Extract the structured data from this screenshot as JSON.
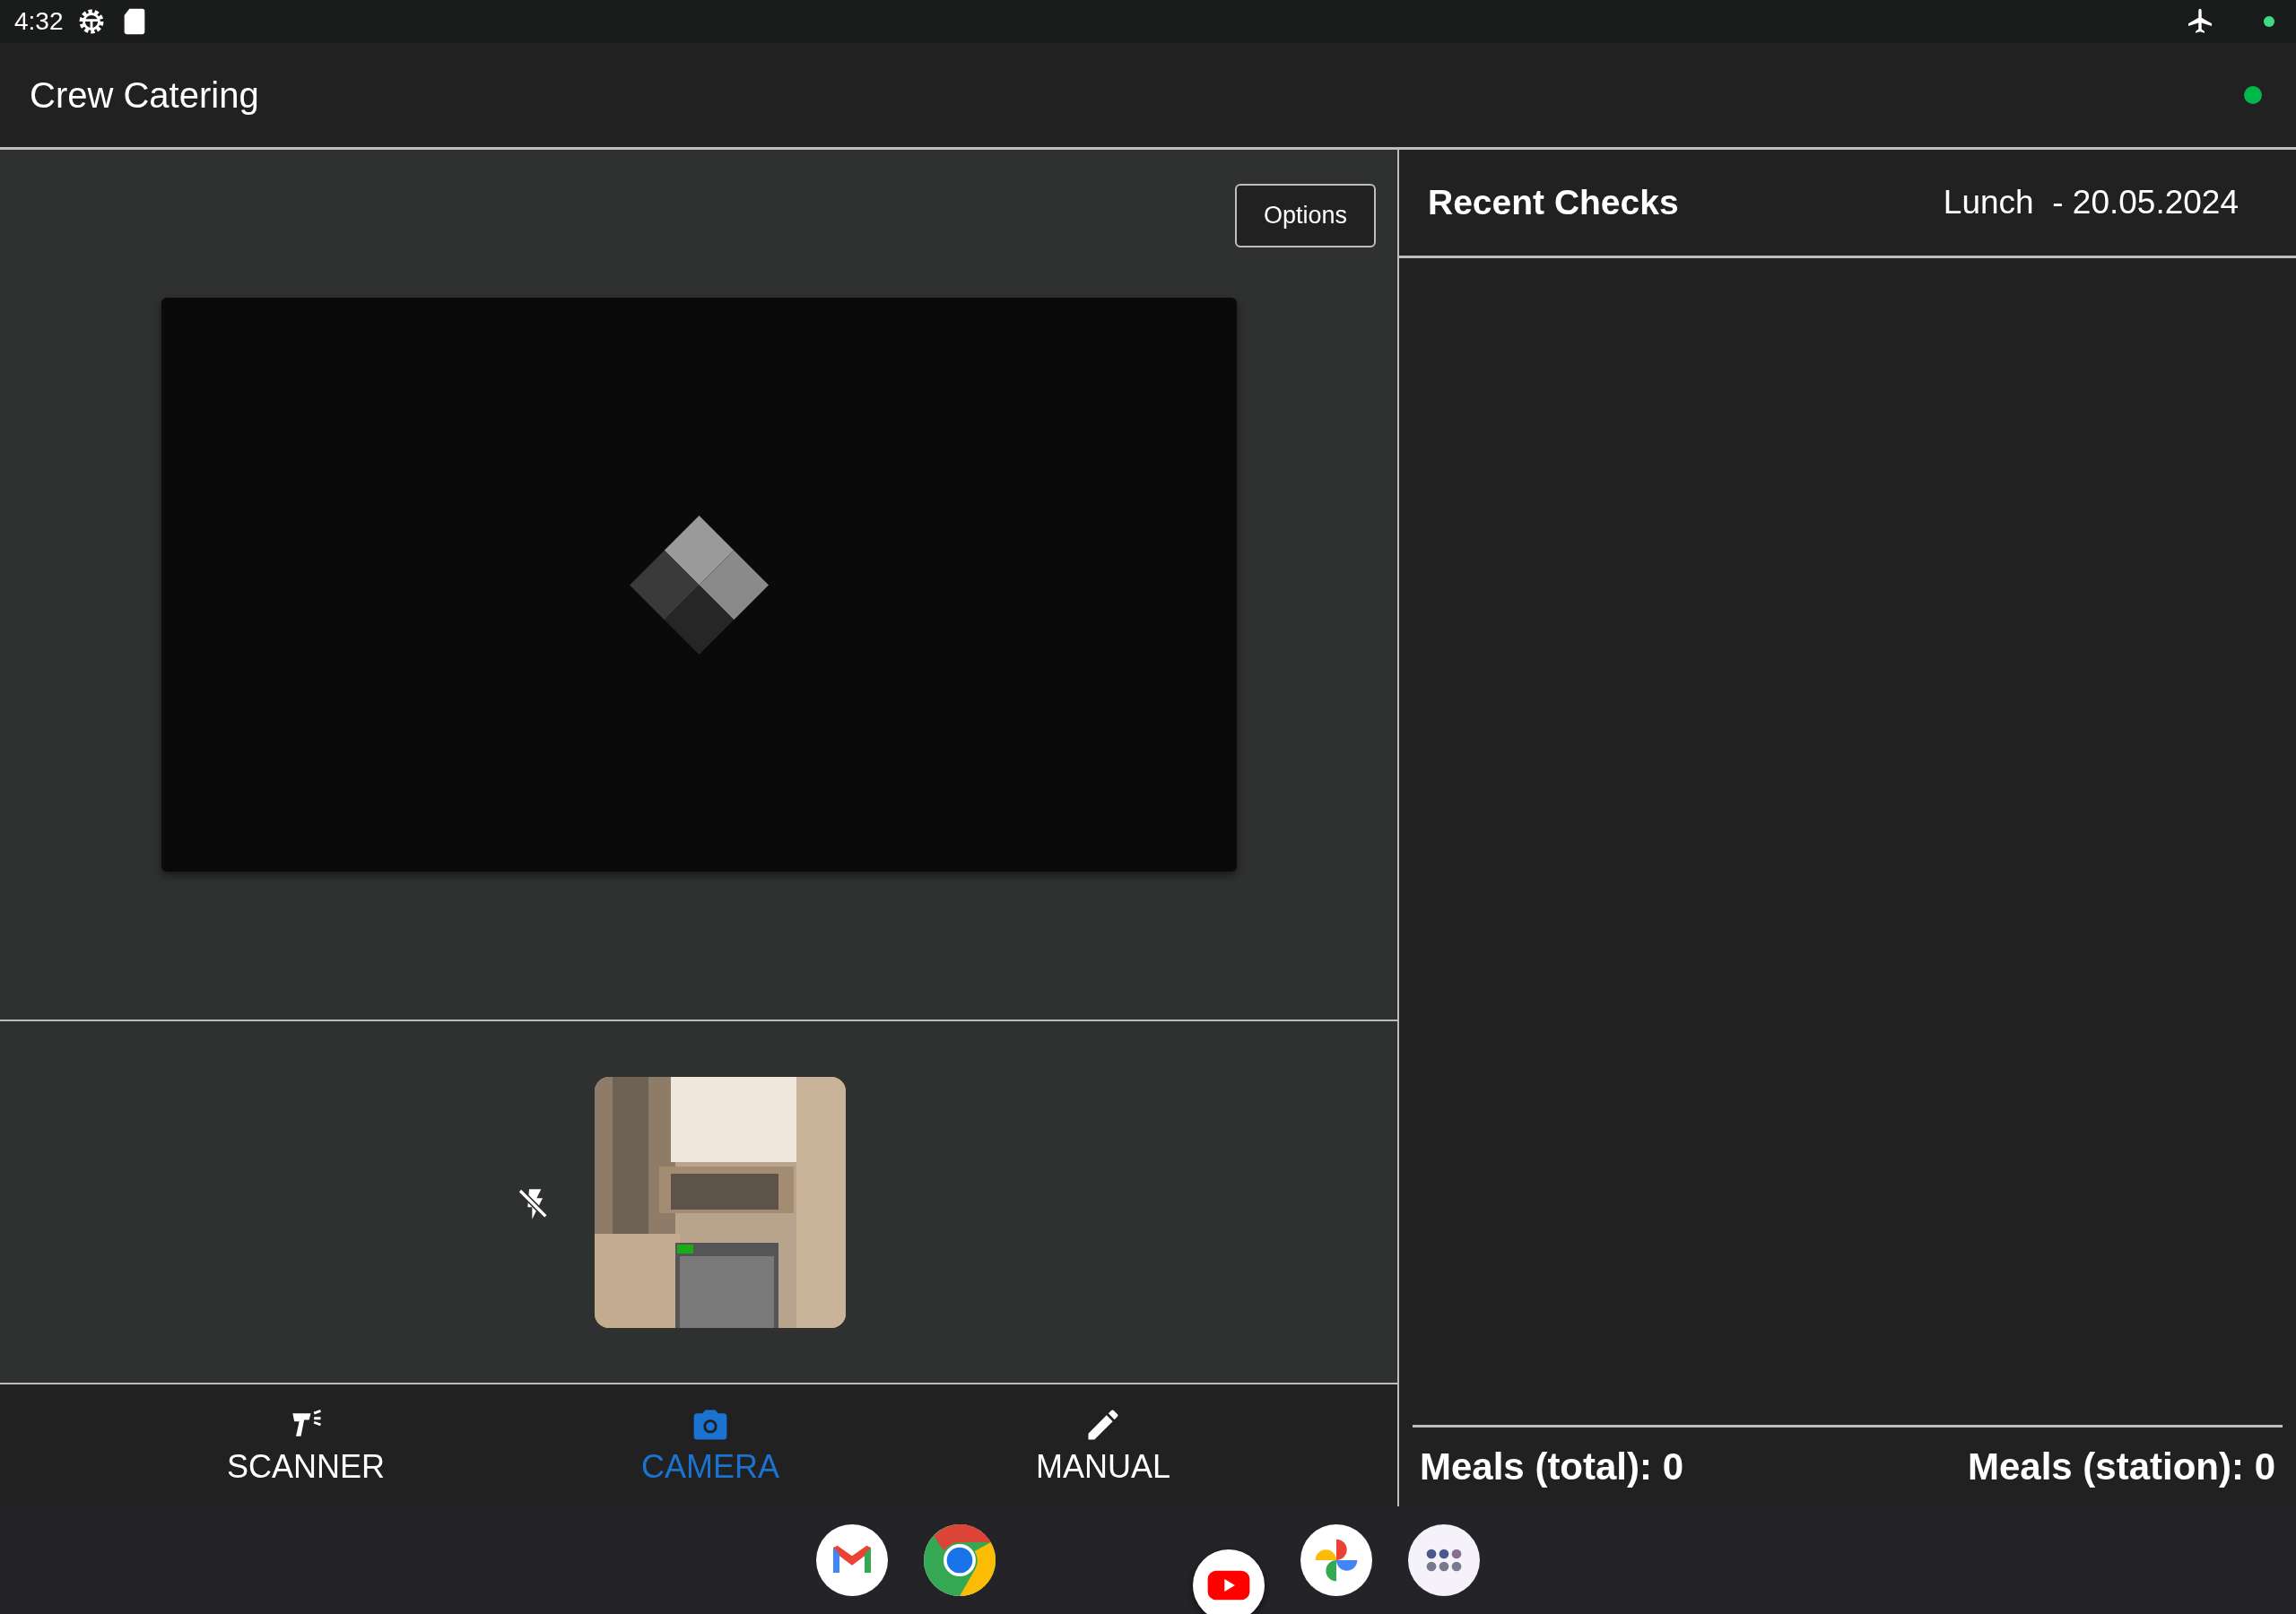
{
  "status_bar": {
    "time": "4:32"
  },
  "app_bar": {
    "title": "Crew Catering"
  },
  "scan_panel": {
    "options_button": "Options"
  },
  "bottom_nav": [
    {
      "label": "SCANNER",
      "kind": "scanner",
      "selected": false
    },
    {
      "label": "CAMERA",
      "kind": "camera",
      "selected": true
    },
    {
      "label": "MANUAL",
      "kind": "manual",
      "selected": false
    }
  ],
  "recent_checks": {
    "title": "Recent Checks",
    "meal": "Lunch",
    "date": "- 20.05.2024"
  },
  "totals": [
    {
      "label": "Meals (total): 0"
    },
    {
      "label": "Meals (station): 0"
    }
  ],
  "dock": [
    {
      "kind": "mail"
    },
    {
      "kind": "browser"
    },
    {
      "kind": "video"
    },
    {
      "kind": "photos"
    },
    {
      "kind": "apps"
    }
  ]
}
